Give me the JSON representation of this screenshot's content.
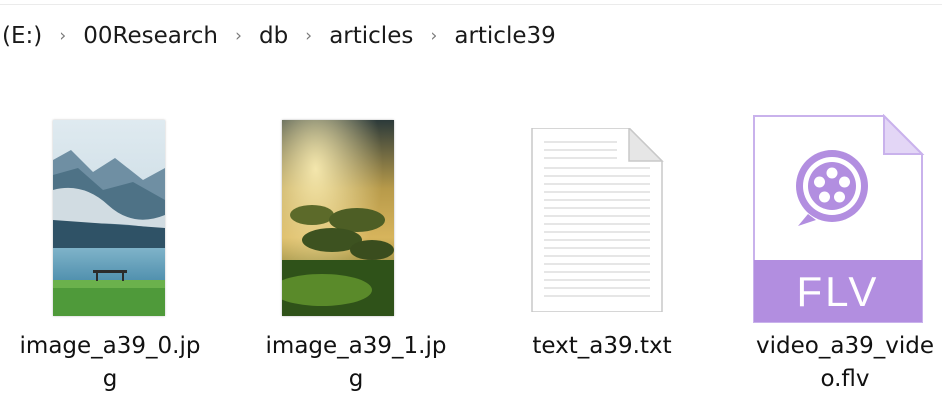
{
  "breadcrumb": {
    "items": [
      "(E:)",
      "00Research",
      "db",
      "articles",
      "article39"
    ],
    "separator": "›"
  },
  "files": [
    {
      "name_line1": "image_a39_0.jp",
      "name_line2": "g",
      "thumbnail": "landscape-lake-photo"
    },
    {
      "name_line1": "image_a39_1.jp",
      "name_line2": "g",
      "thumbnail": "misty-valley-photo"
    },
    {
      "name_line1": "text_a39.txt",
      "name_line2": "",
      "thumbnail": "text-document-icon"
    },
    {
      "name_line1": "video_a39_vide",
      "name_line2": "o.flv",
      "thumbnail": "flv-video-file-icon",
      "badge": "FLV"
    }
  ],
  "colors": {
    "flv_accent": "#b28ee0",
    "flv_border": "#c9b2ec",
    "text_primary": "#1a1a1a",
    "separator": "#7a7a7a"
  }
}
